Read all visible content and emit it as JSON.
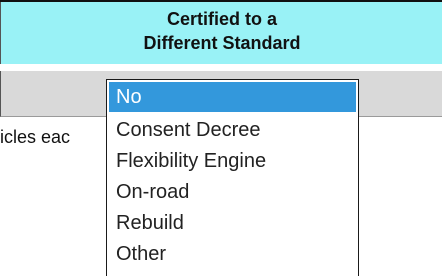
{
  "header": {
    "line1": "Certified to a",
    "line2": "Different Standard"
  },
  "body_text": "icles eac",
  "dropdown": {
    "selected": "No",
    "options": [
      "No",
      "Consent Decree",
      "Flexibility Engine",
      "On-road",
      "Rebuild",
      "Other"
    ]
  },
  "colors": {
    "header_bg": "#99f2f6",
    "select_row_bg": "#d9d9d9",
    "selected_option_bg": "#3398dc"
  }
}
